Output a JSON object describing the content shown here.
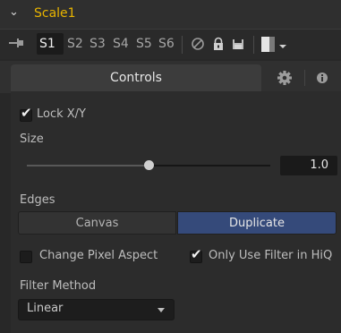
{
  "header": {
    "tool_name": "Scale1",
    "expand_glyph": "⌄"
  },
  "toolbar": {
    "slots": [
      "S1",
      "S2",
      "S3",
      "S4",
      "S5",
      "S6"
    ],
    "active_slot": "S1"
  },
  "tabs": {
    "controls_label": "Controls",
    "settings_icon": "gear-icon",
    "info_icon": "info-icon"
  },
  "controls": {
    "lock_xy": {
      "label": "Lock X/Y",
      "checked": true,
      "mark": "✔"
    },
    "size": {
      "label": "Size",
      "value": "1.0",
      "slider_fraction": 0.5
    },
    "edges": {
      "label": "Edges",
      "options": [
        "Canvas",
        "Duplicate"
      ],
      "selected": "Duplicate"
    },
    "change_pixel_aspect": {
      "label": "Change Pixel Aspect",
      "checked": false
    },
    "only_use_filter": {
      "label": "Only Use Filter in HiQ",
      "checked": true,
      "mark": "✔"
    },
    "filter_method": {
      "label": "Filter Method",
      "value": "Linear"
    }
  },
  "colors": {
    "tool_name": "#e8b400",
    "selected_button": "#354a7a",
    "background": "#282828"
  }
}
